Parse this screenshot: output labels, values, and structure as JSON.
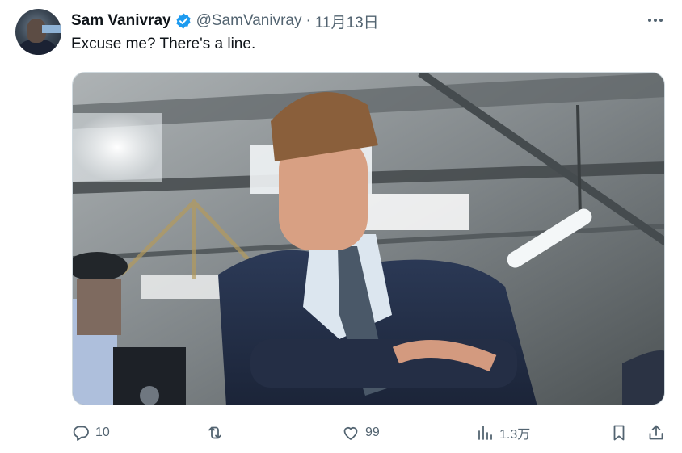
{
  "author": {
    "name": "Sam Vanivray",
    "handle": "@SamVanivray",
    "separator": "·",
    "date": "11月13日",
    "verified": true
  },
  "tweet": {
    "text": "Excuse me? There's a line."
  },
  "actions": {
    "reply_count": "10",
    "like_count": "99",
    "view_count": "1.3万"
  },
  "icons": {
    "reply": "reply-icon",
    "retweet": "retweet-icon",
    "like": "heart-icon",
    "views": "views-chart-icon",
    "bookmark": "bookmark-icon",
    "share": "share-icon",
    "more": "more-icon",
    "verified": "verified-badge-icon"
  },
  "colors": {
    "text": "#0f1419",
    "secondary": "#536471",
    "verified": "#1d9bf0"
  }
}
